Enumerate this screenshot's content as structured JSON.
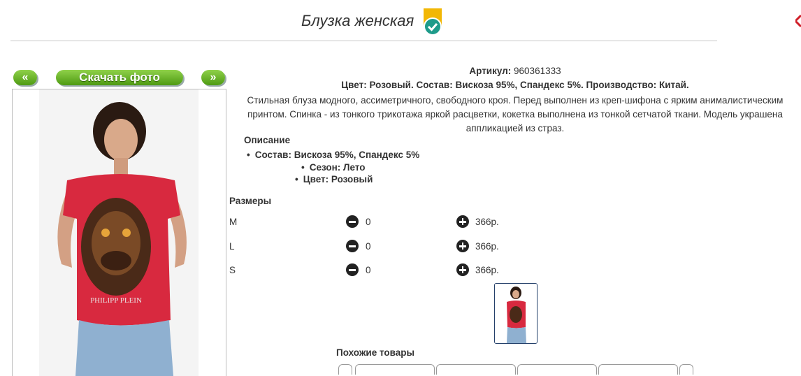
{
  "product": {
    "title": "Блузка женская",
    "sku_label": "Артикул:",
    "sku_value": "960361333",
    "summary": "Цвет: Розовый. Состав: Вискоза 95%, Спандекс 5%. Производство: Китай.",
    "description": "Стильная блуза модного, ассиметричного, свободного кроя. Перед выполнен из креп-шифона с ярким анималистическим принтом. Спинка - из тонкого трикотажа яркой расцветки, кокетка выполнена из тонкой сетчатой ткани. Модель украшена аппликацией из страз."
  },
  "gallery": {
    "prev_label": "«",
    "next_label": "»",
    "download_label": "Скачать фото",
    "print_text": "PHILIPP PLEIN"
  },
  "details": {
    "heading": "Описание",
    "items": [
      "Состав: Вискоза 95%, Спандекс 5%",
      "Сезон: Лето",
      "Цвет: Розовый"
    ]
  },
  "sizes": {
    "heading": "Размеры",
    "rows": [
      {
        "size": "M",
        "qty": "0",
        "price": "366р."
      },
      {
        "size": "L",
        "qty": "0",
        "price": "366р."
      },
      {
        "size": "S",
        "qty": "0",
        "price": "366р."
      }
    ]
  },
  "similar": {
    "heading": "Похожие товары"
  },
  "colors": {
    "button_green": "#5aa81a",
    "badge_gold": "#f2b705",
    "badge_teal": "#1e9b8a",
    "shirt_red": "#d8293f"
  }
}
